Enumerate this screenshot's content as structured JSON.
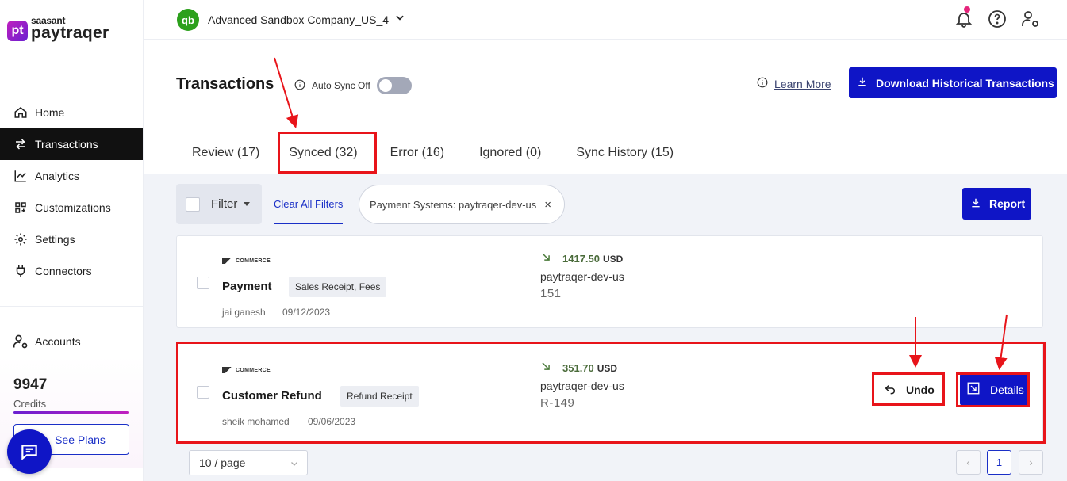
{
  "brand": {
    "mark": "pt",
    "top": "saasant",
    "name": "paytraqer"
  },
  "nav": [
    {
      "label": "Home",
      "icon": "home-icon"
    },
    {
      "label": "Transactions",
      "icon": "transfer-icon",
      "active": true
    },
    {
      "label": "Analytics",
      "icon": "chart-icon"
    },
    {
      "label": "Customizations",
      "icon": "grid-icon"
    },
    {
      "label": "Settings",
      "icon": "gear-icon"
    },
    {
      "label": "Connectors",
      "icon": "plug-icon"
    }
  ],
  "accounts_label": "Accounts",
  "credits": {
    "value": "9947",
    "label": "Credits"
  },
  "see_plans": "See Plans",
  "topbar": {
    "qb_logo": "qb",
    "company": "Advanced Sandbox Company_US_4"
  },
  "page": {
    "title": "Transactions",
    "auto_sync": "Auto Sync Off",
    "learn_more": "Learn More",
    "download_btn": "Download Historical Transactions"
  },
  "tabs": [
    {
      "label": "Review (17)"
    },
    {
      "label": "Synced (32)",
      "active": true
    },
    {
      "label": "Error (16)"
    },
    {
      "label": "Ignored (0)"
    },
    {
      "label": "Sync History (15)"
    }
  ],
  "filters": {
    "filter_label": "Filter",
    "clear_all": "Clear All Filters",
    "chip": "Payment Systems: paytraqer-dev-us",
    "chip_close": "×",
    "report": "Report"
  },
  "transactions": [
    {
      "source": "COMMERCE",
      "type": "Payment",
      "tag": "Sales Receipt, Fees",
      "user": "jai ganesh",
      "date": "09/12/2023",
      "amount": "1417.50",
      "currency": "USD",
      "payment_system": "paytraqer-dev-us",
      "ref": "151"
    },
    {
      "source": "COMMERCE",
      "type": "Customer Refund",
      "tag": "Refund Receipt",
      "user": "sheik mohamed",
      "date": "09/06/2023",
      "amount": "351.70",
      "currency": "USD",
      "payment_system": "paytraqer-dev-us",
      "ref": "R-149",
      "undo": "Undo",
      "details": "Details"
    }
  ],
  "pagination": {
    "per_page": "10 / page",
    "current": "1",
    "prev": "‹",
    "next": "›"
  },
  "colors": {
    "primary": "#0f15c6",
    "annotation": "#e8141a",
    "amount": "#4a6b3a"
  }
}
